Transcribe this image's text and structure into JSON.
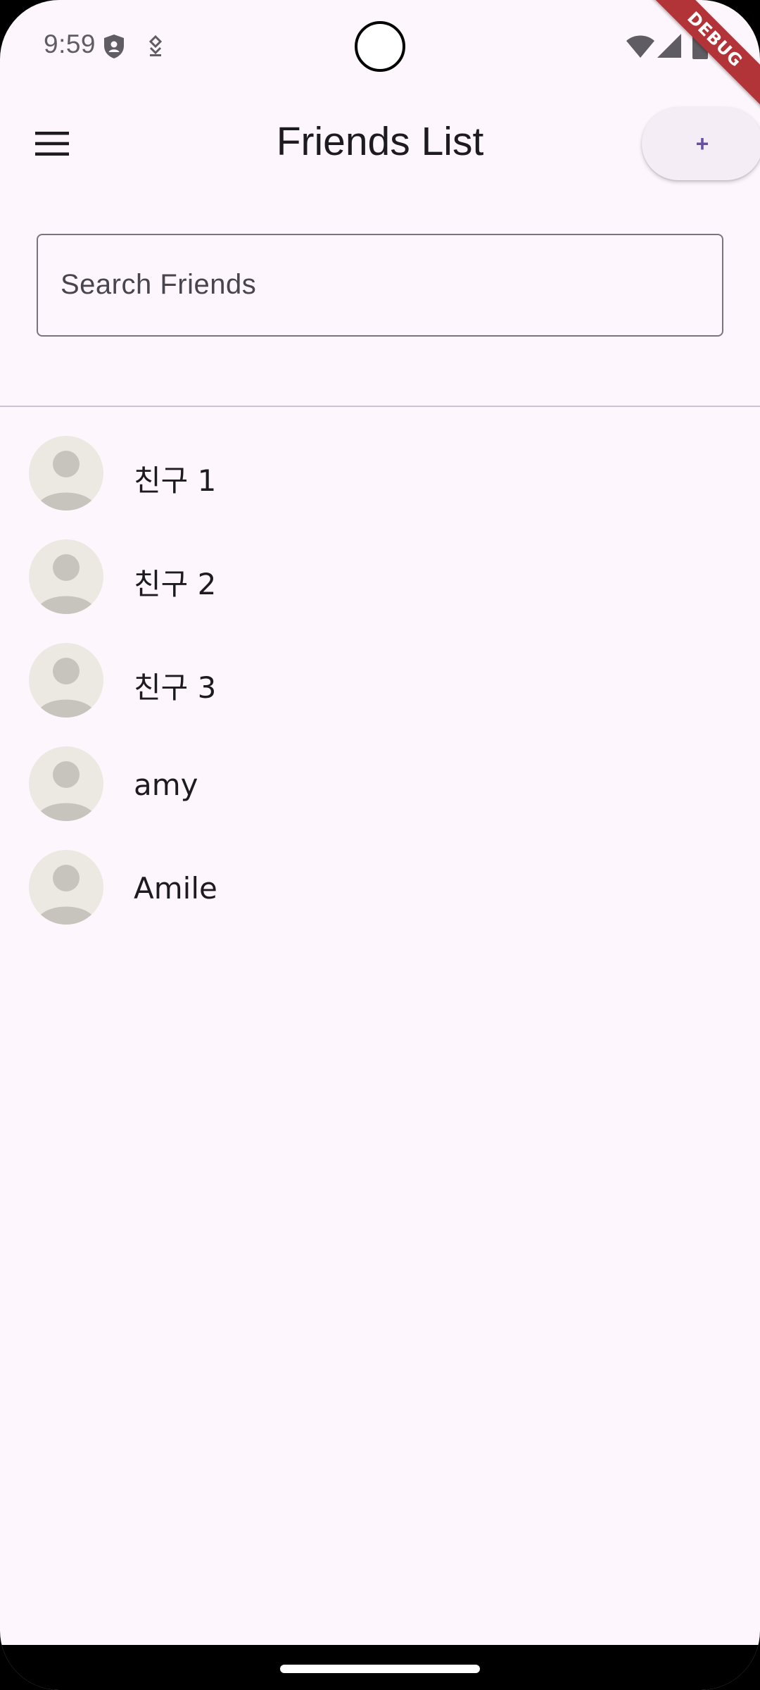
{
  "status_bar": {
    "time": "9:59",
    "icons": [
      "shield-icon",
      "tether-icon",
      "wifi-icon",
      "cell-signal-icon",
      "battery-icon"
    ]
  },
  "debug_banner": "DEBUG",
  "app_bar": {
    "title": "Friends List",
    "menu_icon": "hamburger-menu-icon",
    "add_label": "+"
  },
  "search": {
    "placeholder": "Search Friends",
    "value": ""
  },
  "friends": [
    {
      "name": "친구 1",
      "avatar": "person-placeholder-icon"
    },
    {
      "name": "친구 2",
      "avatar": "person-placeholder-icon"
    },
    {
      "name": "친구 3",
      "avatar": "person-placeholder-icon"
    },
    {
      "name": "amy",
      "avatar": "person-placeholder-icon"
    },
    {
      "name": "Amile",
      "avatar": "person-placeholder-icon"
    }
  ],
  "colors": {
    "background": "#fdf7fd",
    "accent": "#6750a4",
    "avatar_bg": "#ece9e3",
    "avatar_fg": "#c7c4bd",
    "debug_ribbon": "#b23438"
  }
}
